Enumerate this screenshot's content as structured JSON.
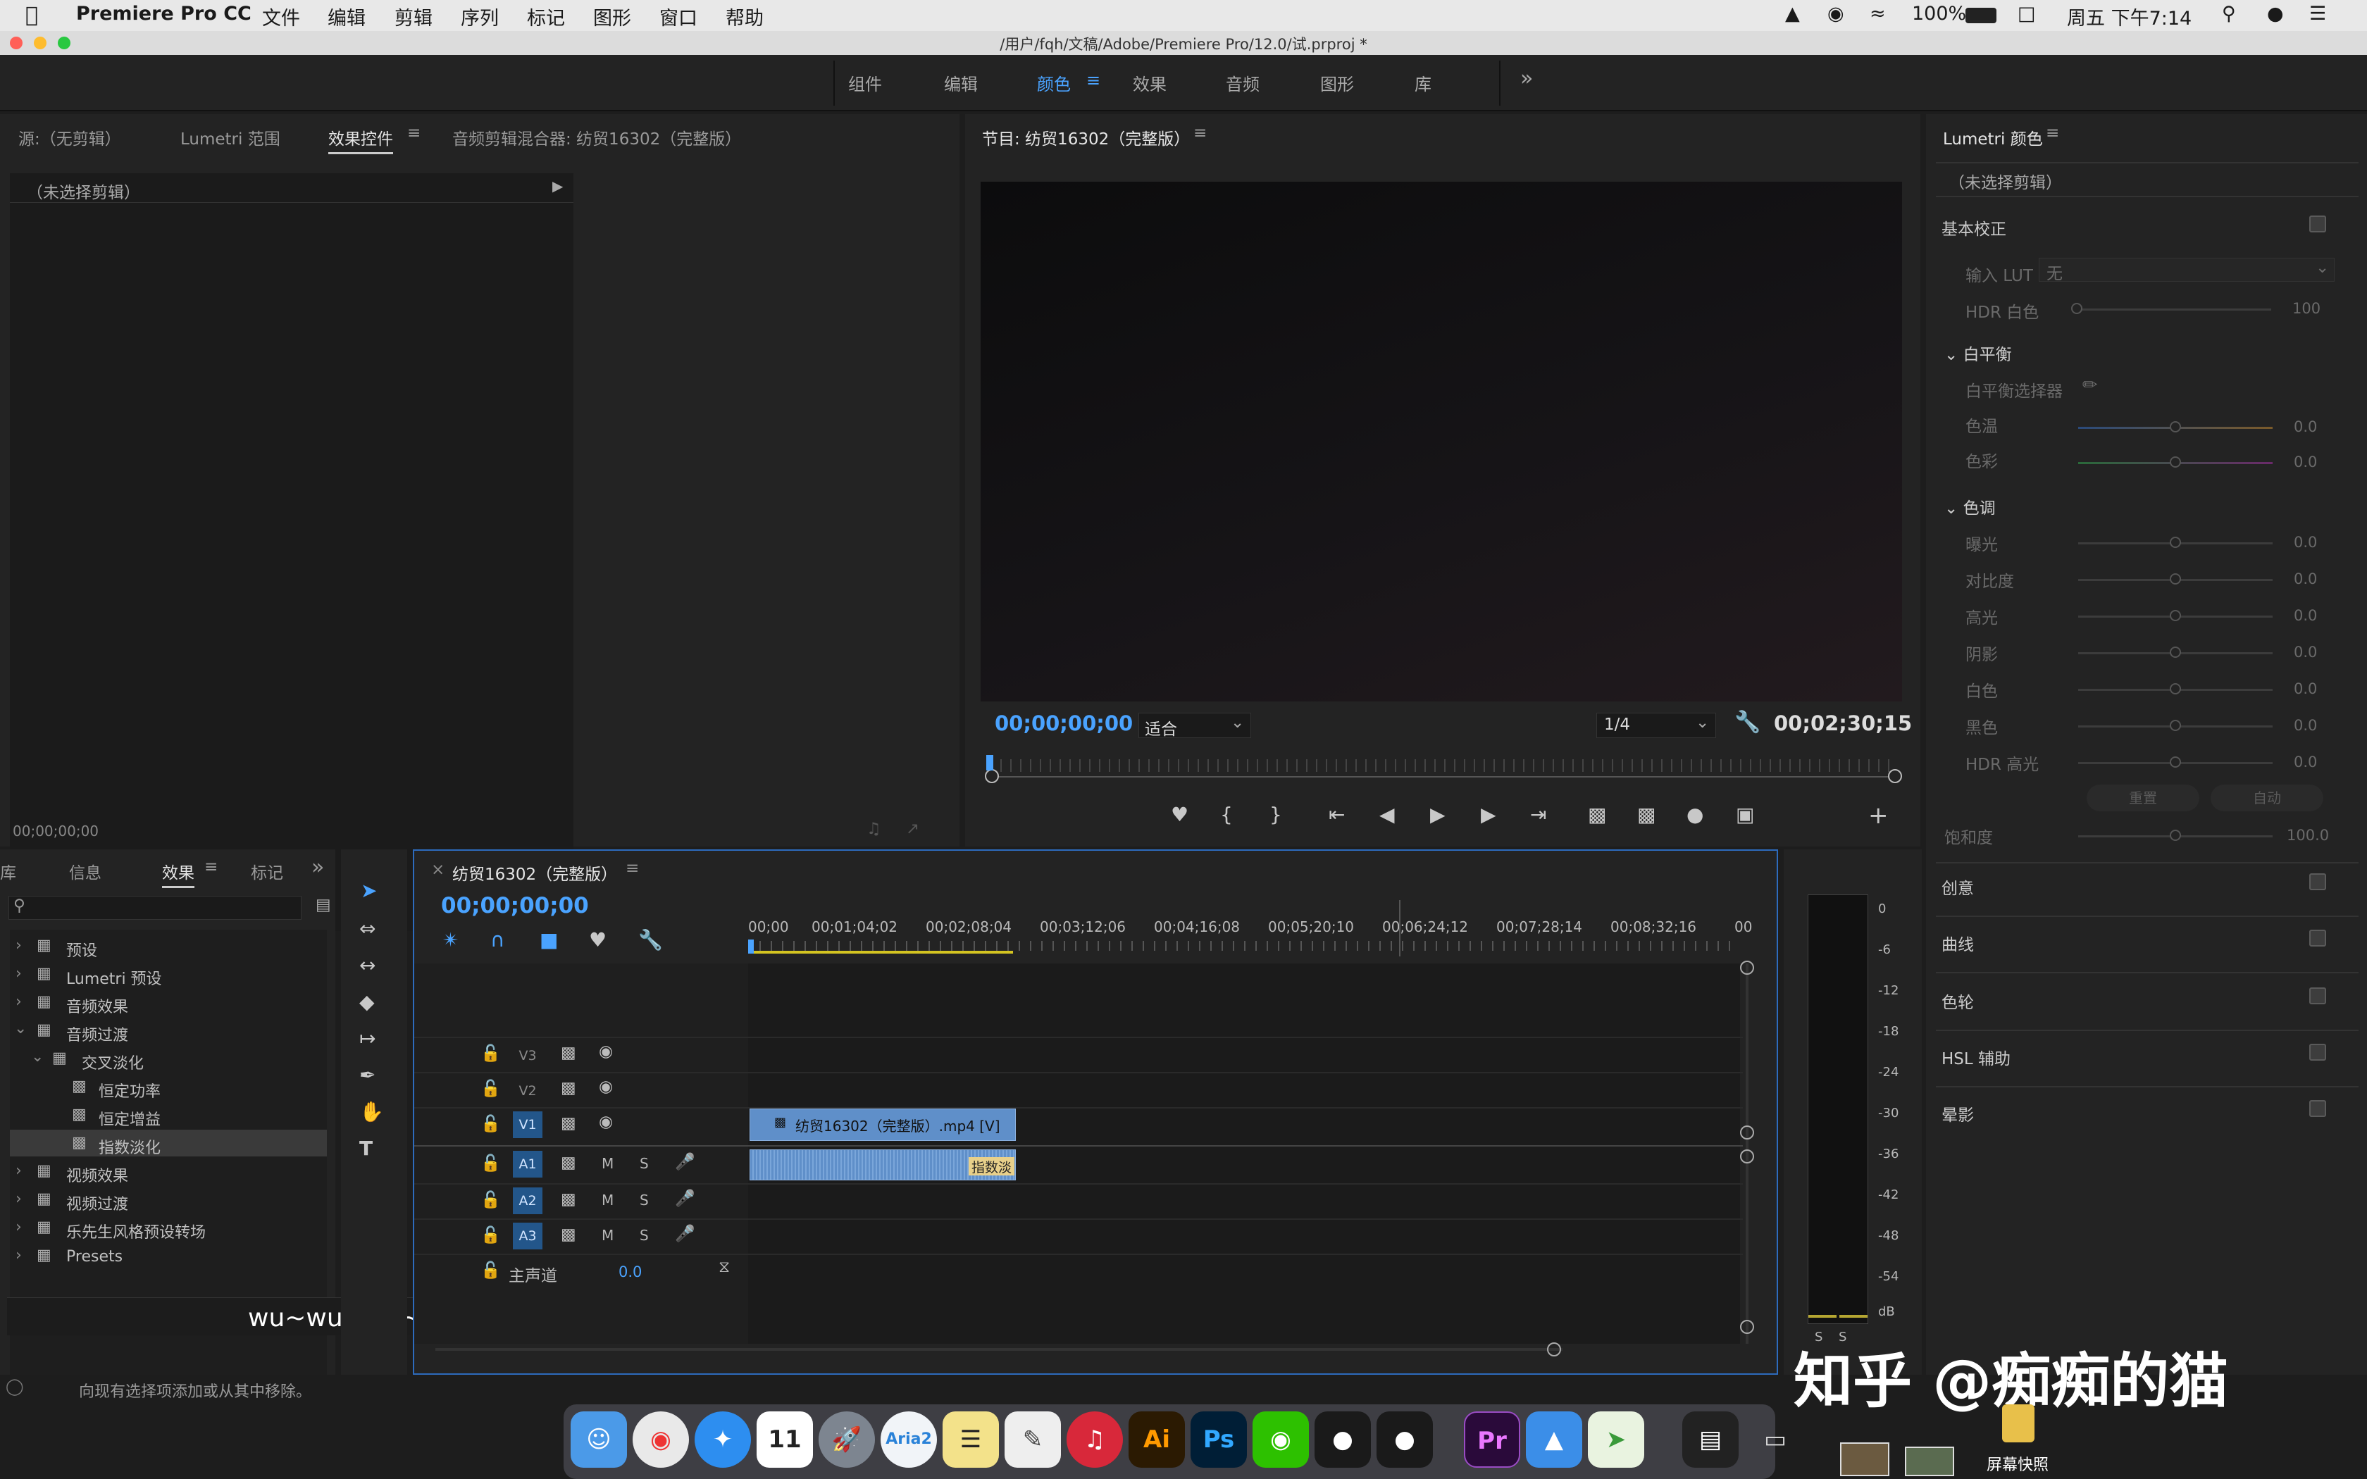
{
  "menubar": {
    "app": "Premiere Pro CC",
    "items": [
      "文件",
      "编辑",
      "剪辑",
      "序列",
      "标记",
      "图形",
      "窗口",
      "帮助"
    ],
    "battery": "100%",
    "clock": "周五 下午7:14"
  },
  "window": {
    "title": "/用户/fqh/文稿/Adobe/Premiere Pro/12.0/试.prproj *"
  },
  "workspaces": [
    "组件",
    "编辑",
    "颜色",
    "效果",
    "音频",
    "图形",
    "库"
  ],
  "workspaces_more": "»",
  "source_panel": {
    "tabs": [
      "源:（无剪辑）",
      "Lumetri 范围",
      "效果控件",
      "音频剪辑混合器: 纺贸16302（完整版）"
    ],
    "no_clip": "（未选择剪辑）",
    "timecode": "00;00;00;00"
  },
  "program": {
    "title": "节目: 纺贸16302（完整版）",
    "timecode": "00;00;00;00",
    "fit": "适合",
    "res": "1/4",
    "duration": "00;02;30;15"
  },
  "lumetri": {
    "title": "Lumetri 颜色",
    "no_clip": "（未选择剪辑）",
    "basic": "基本校正",
    "lut_label": "输入 LUT",
    "lut_value": "无",
    "hdr_white": "HDR 白色",
    "hdr_white_val": "100",
    "wb": "白平衡",
    "wb_picker": "白平衡选择器",
    "temp": "色温",
    "tint": "色彩",
    "tone": "色调",
    "exposure": "曝光",
    "contrast": "对比度",
    "highlights": "高光",
    "shadows": "阴影",
    "whites": "白色",
    "blacks": "黑色",
    "hdr_spec": "HDR 高光",
    "zero": "0.0",
    "reset": "重置",
    "auto": "自动",
    "saturation": "饱和度",
    "sat_val": "100.0",
    "creative": "创意",
    "curves": "曲线",
    "wheels": "色轮",
    "hsl": "HSL 辅助",
    "vignette": "晕影"
  },
  "effects_panel": {
    "tabs": [
      "库",
      "信息",
      "效果",
      "标记"
    ],
    "more": "»",
    "tree": [
      "预设",
      "Lumetri 预设",
      "音频效果",
      "音频过渡",
      "交叉淡化",
      "恒定功率",
      "恒定增益",
      "指数淡化",
      "视频效果",
      "视频过渡",
      "乐先生风格预设转场",
      "Presets"
    ]
  },
  "timeline": {
    "title": "纺贸16302（完整版）",
    "timecode": "00;00;00;00",
    "ruler": [
      "00;00",
      "00;01;04;02",
      "00;02;08;04",
      "00;03;12;06",
      "00;04;16;08",
      "00;05;20;10",
      "00;06;24;12",
      "00;07;28;14",
      "00;08;32;16",
      "00"
    ],
    "video_tracks": [
      "V3",
      "V2",
      "V1"
    ],
    "audio_tracks": [
      "A1",
      "A2",
      "A3"
    ],
    "mute": "M",
    "solo": "S",
    "master": "主声道",
    "master_val": "0.0",
    "clip_name": "纺贸16302（完整版）.mp4 [V]",
    "audio_fx": "指数淡"
  },
  "meter": {
    "ticks": [
      "0",
      "-6",
      "-12",
      "-18",
      "-24",
      "-30",
      "-36",
      "-42",
      "-48",
      "-54",
      "dB"
    ],
    "solo": [
      "S",
      "S"
    ]
  },
  "status": "向现有选择项添加或从其中移除。",
  "overlay_caption": "wu~wu~wu~",
  "watermark": "知乎 @痴痴的猫",
  "dock_label": "屏幕快照",
  "dock": {
    "aria": "Aria2",
    "ai": "Ai",
    "ps": "Ps",
    "pr": "Pr",
    "cal": "11"
  },
  "colors": {
    "accent": "#4aa3ff",
    "clip": "#5f8fc9",
    "panel": "#232323"
  }
}
